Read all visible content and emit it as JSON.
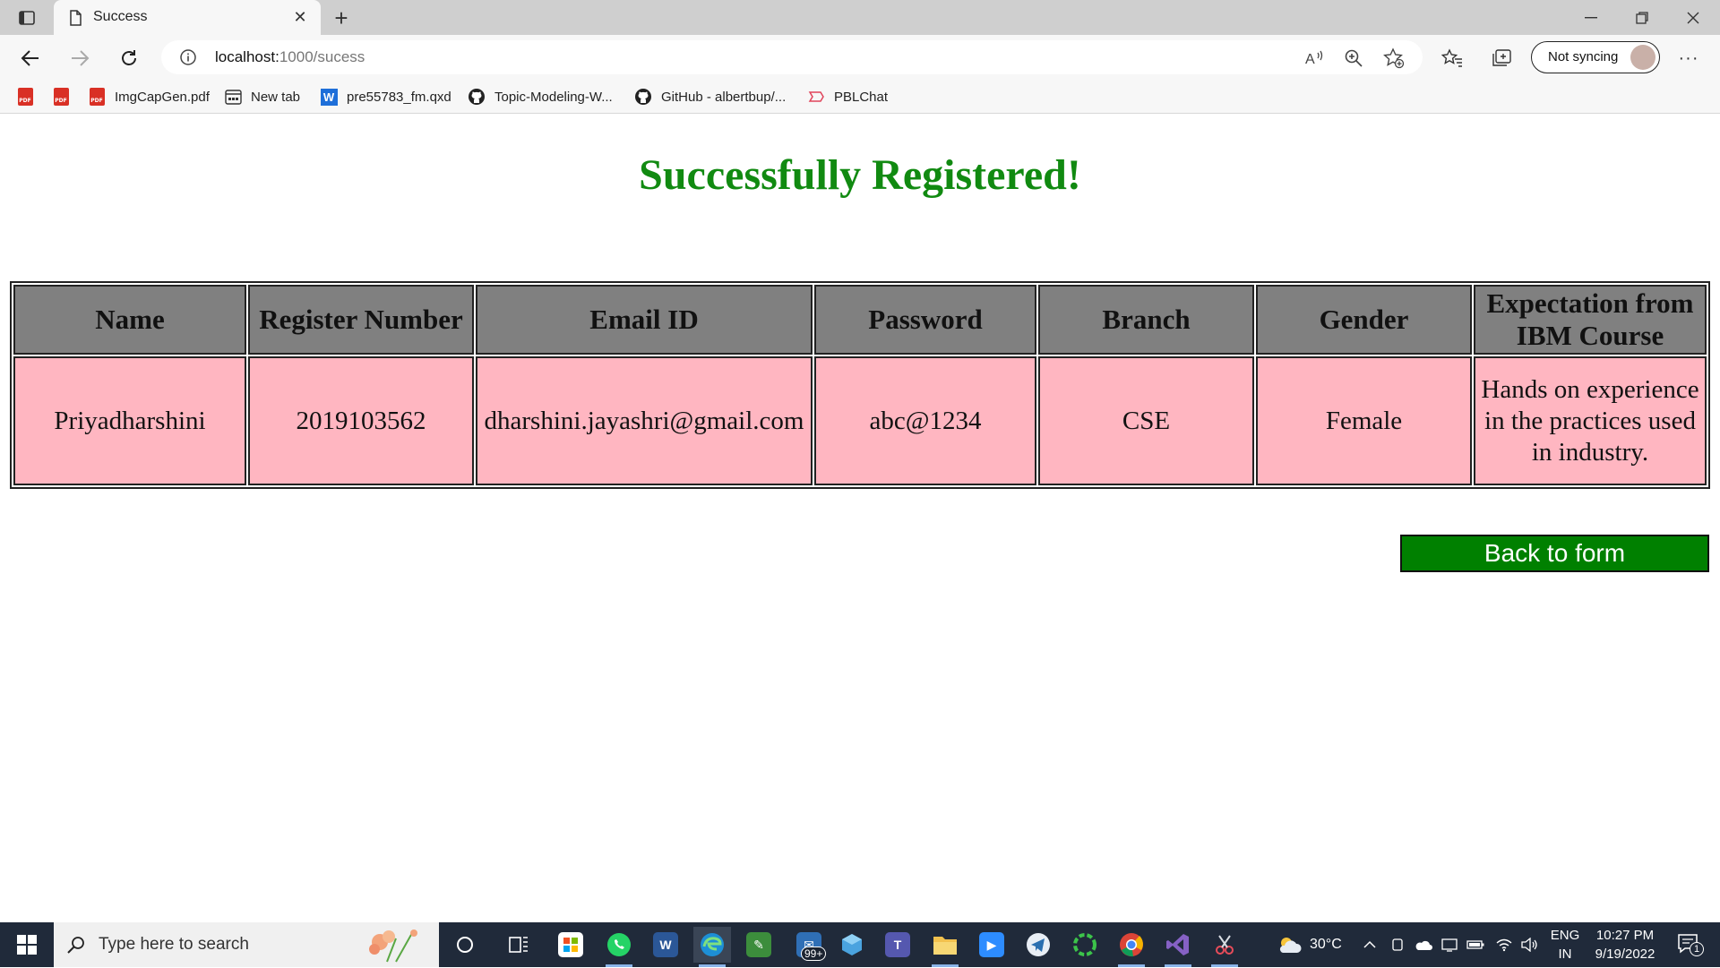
{
  "browser": {
    "tab_title": "Success",
    "url_host": "localhost:",
    "url_path": "1000/sucess",
    "profile_label": "Not syncing",
    "bookmarks": [
      {
        "label": "",
        "icon": "pdf-icon"
      },
      {
        "label": "",
        "icon": "pdf-icon"
      },
      {
        "label": "ImgCapGen.pdf",
        "icon": "pdf-icon"
      },
      {
        "label": "New tab",
        "icon": "new-tab-page-icon"
      },
      {
        "label": "pre55783_fm.qxd",
        "icon": "word-icon"
      },
      {
        "label": "Topic-Modeling-W...",
        "icon": "github-icon"
      },
      {
        "label": "GitHub - albertbup/...",
        "icon": "github-icon"
      },
      {
        "label": "PBLChat",
        "icon": "chat-icon"
      }
    ]
  },
  "page": {
    "heading": "Successfully Registered!",
    "heading_color": "#118a11",
    "table": {
      "headers": [
        "Name",
        "Register Number",
        "Email ID",
        "Password",
        "Branch",
        "Gender",
        "Expectation from IBM Course"
      ],
      "rows": [
        [
          "Priyadharshini",
          "2019103562",
          "dharshini.jayashri@gmail.com",
          "abc@1234",
          "CSE",
          "Female",
          "Hands on experience in the practices used in industry."
        ]
      ],
      "header_bg": "#808080",
      "cell_bg": "#ffb6c1"
    },
    "back_button_label": "Back to form",
    "back_button_color": "#008000"
  },
  "taskbar": {
    "search_placeholder": "Type here to search",
    "temperature": "30°C",
    "language_line1": "ENG",
    "language_line2": "IN",
    "time": "10:27 PM",
    "date": "9/19/2022",
    "mail_badge": "99+",
    "notification_count": "1"
  }
}
